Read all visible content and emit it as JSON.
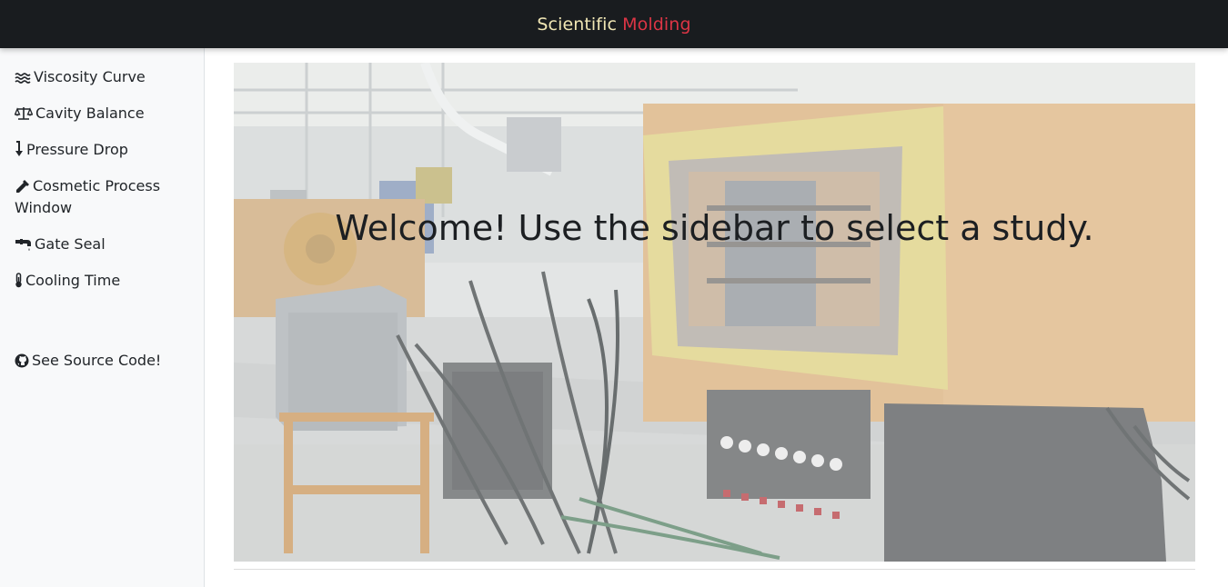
{
  "brand": {
    "part1": "Scientific",
    "part2": "Molding",
    "part1_color": "#f0e6b4",
    "part2_color": "#dc3545"
  },
  "sidebar": {
    "items": [
      {
        "label": "Viscosity Curve",
        "icon": "water-waves-icon"
      },
      {
        "label": "Cavity Balance",
        "icon": "balance-scale-icon"
      },
      {
        "label": "Pressure Drop",
        "icon": "arrow-down-icon"
      },
      {
        "label": "Cosmetic Process Window",
        "icon": "eyedropper-icon"
      },
      {
        "label": "Gate Seal",
        "icon": "faucet-icon"
      },
      {
        "label": "Cooling Time",
        "icon": "thermometer-icon"
      }
    ],
    "source_link": {
      "label": "See Source Code!",
      "icon": "github-icon"
    }
  },
  "main": {
    "welcome": "Welcome! Use the sidebar to select a study.",
    "hero_image": "injection-molding-machine-photo"
  }
}
